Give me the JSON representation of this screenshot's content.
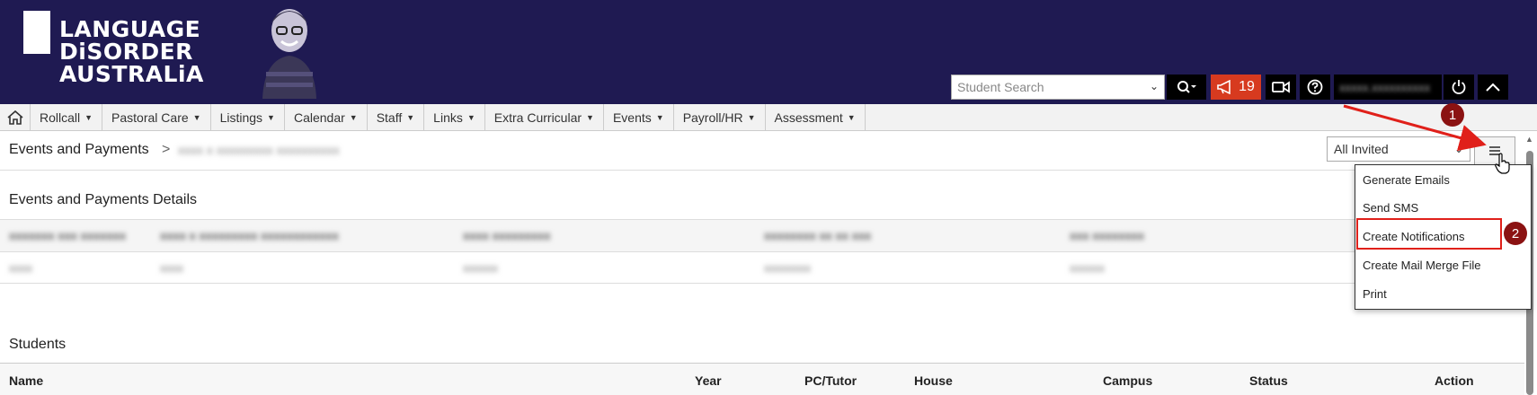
{
  "header": {
    "logo_line1": "LANGUAGE",
    "logo_line2": "DiSORDER",
    "logo_line3": "AUSTRALiA",
    "search_placeholder": "Student Search",
    "alert_count": "19",
    "user_name": "xxxxx.xxxxxxxxxx"
  },
  "nav": {
    "items": [
      {
        "label": "Rollcall"
      },
      {
        "label": "Pastoral Care"
      },
      {
        "label": "Listings"
      },
      {
        "label": "Calendar"
      },
      {
        "label": "Staff"
      },
      {
        "label": "Links"
      },
      {
        "label": "Extra Curricular"
      },
      {
        "label": "Events"
      },
      {
        "label": "Payroll/HR"
      },
      {
        "label": "Assessment"
      }
    ]
  },
  "page": {
    "breadcrumb_main": "Events and Payments",
    "breadcrumb_sep": ">",
    "breadcrumb_current": "xxxx x xxxxxxxxx xxxxxxxxxx",
    "invite_filter": "All Invited"
  },
  "details": {
    "title": "Events and Payments Details",
    "row1": [
      "xxxxxxx xxx xxxxxxx",
      "xxxx x xxxxxxxxx xxxxxxxxxxxx",
      "xxxx xxxxxxxxx",
      "xxxxxxxx xx xx xxx",
      "xxx xxxxxxxx"
    ],
    "row2": [
      "xxxx",
      "xxxx",
      "xxxxxx",
      "xxxxxxxx",
      "xxxxxx"
    ]
  },
  "students": {
    "title": "Students",
    "columns": [
      "Name",
      "Year",
      "PC/Tutor",
      "House",
      "Campus",
      "Status",
      "Action"
    ]
  },
  "dropdown": {
    "items": [
      "Generate Emails",
      "Send SMS",
      "Create Notifications",
      "Create Mail Merge File",
      "Print"
    ]
  },
  "annotations": {
    "step1": "1",
    "step2": "2",
    "color": "#e0201a"
  }
}
